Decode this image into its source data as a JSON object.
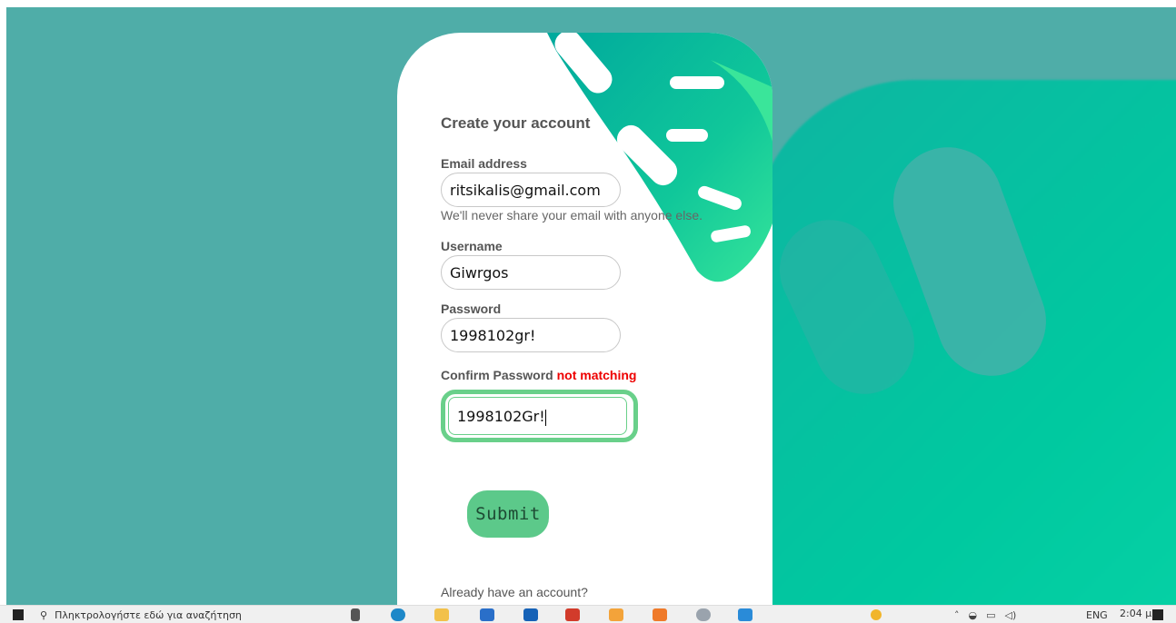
{
  "form": {
    "title": "Create your account",
    "email": {
      "label": "Email address",
      "value": "ritsikalis@gmail.com",
      "hint": "We'll never share your email with anyone else."
    },
    "username": {
      "label": "Username",
      "value": "Giwrgos"
    },
    "password": {
      "label": "Password",
      "value": "1998102gr!"
    },
    "confirm": {
      "label": "Confirm Password",
      "status": "not matching",
      "value": "1998102Gr!"
    },
    "submit_label": "Submit",
    "already": "Already have an account?"
  },
  "taskbar": {
    "search_placeholder": "Πληκτρολογήστε εδώ για αναζήτηση",
    "time": "2:04 μμ",
    "lang": "ENG"
  },
  "colors": {
    "background": "#4fada8",
    "accent_green": "#5cc98a",
    "warning": "#ee0000"
  }
}
